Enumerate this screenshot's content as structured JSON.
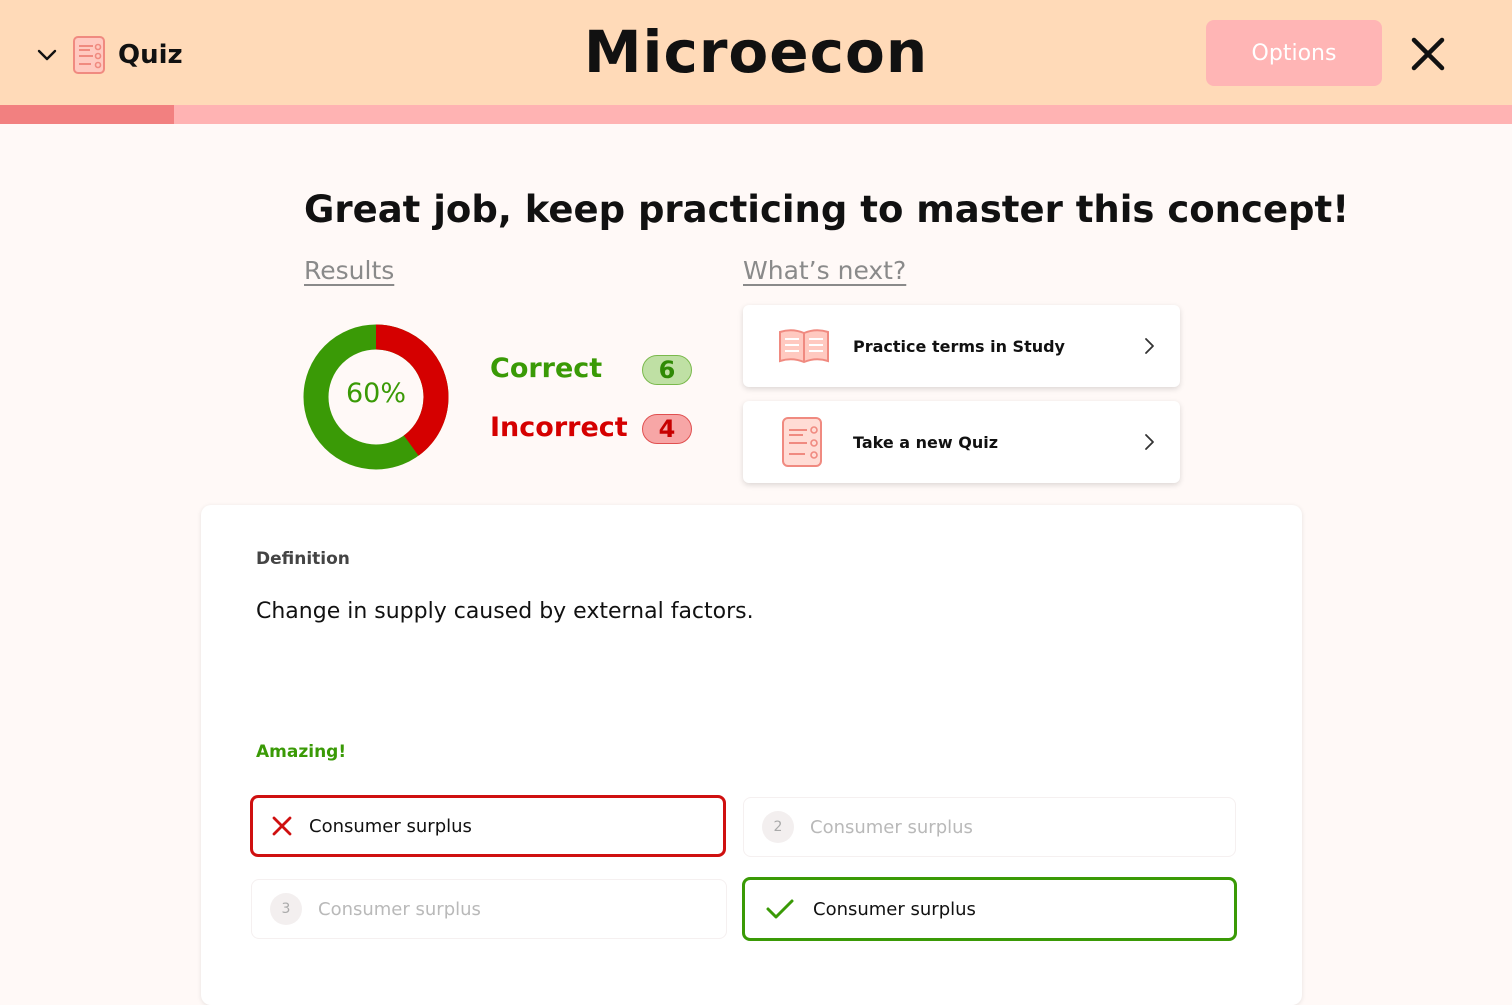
{
  "header": {
    "mode_label": "Quiz",
    "title": "Microecon",
    "options_label": "Options",
    "progress_fraction": 0.115
  },
  "summary": {
    "headline": "Great job, keep practicing to master this concept!",
    "results_label": "Results",
    "next_label": "What’s next?",
    "percent_label": "60%",
    "percent_value": 60,
    "correct_label": "Correct",
    "correct_count": "6",
    "incorrect_label": "Incorrect",
    "incorrect_count": "4"
  },
  "next_actions": [
    {
      "label": "Practice terms in Study",
      "icon": "open-book-icon"
    },
    {
      "label": "Take a new Quiz",
      "icon": "quiz-checklist-icon"
    }
  ],
  "question": {
    "kind": "Definition",
    "text": "Change in supply caused by external factors.",
    "feedback": "Amazing!",
    "answers": [
      {
        "number": "1",
        "text": "Consumer surplus",
        "state": "incorrect"
      },
      {
        "number": "2",
        "text": "Consumer surplus",
        "state": "dimmed"
      },
      {
        "number": "3",
        "text": "Consumer surplus",
        "state": "dimmed"
      },
      {
        "number": "4",
        "text": "Consumer surplus",
        "state": "correct"
      }
    ]
  },
  "colors": {
    "header_bg": "#ffdab8",
    "progress_fill": "#f28080",
    "progress_track": "#ffb3b3",
    "correct": "#3a9a06",
    "incorrect": "#d50000",
    "options_button": "#ffb5b5"
  }
}
